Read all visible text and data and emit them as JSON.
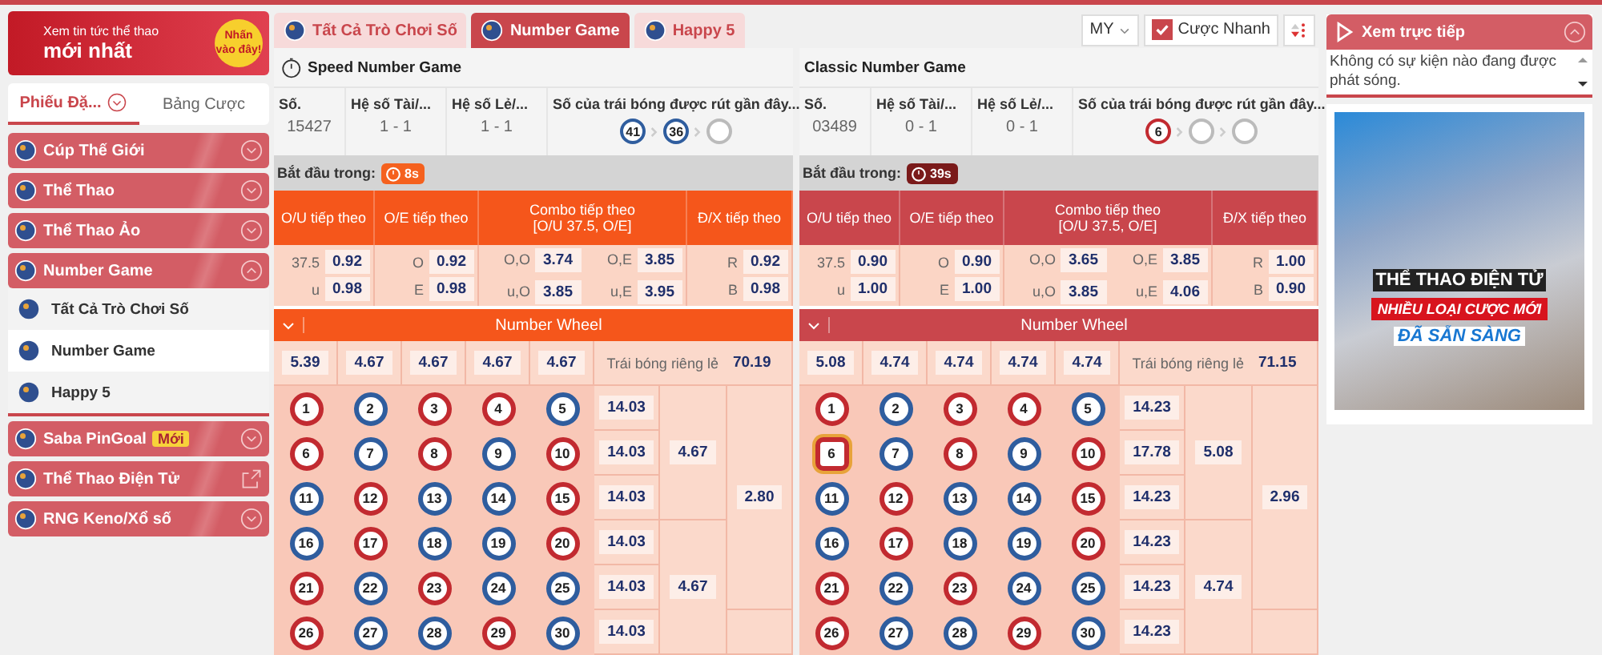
{
  "banner": {
    "line1": "Xem tin tức thể thao",
    "line2": "mới nhất",
    "cta": "Nhấn vào đây!"
  },
  "side_tabs": [
    {
      "label": "Phiếu Đặ...",
      "selected": true
    },
    {
      "label": "Bảng Cược",
      "selected": false
    }
  ],
  "menu": [
    {
      "label": "Cúp Thế Giới",
      "kind": "group",
      "expanded": false
    },
    {
      "label": "Thể Thao",
      "kind": "group",
      "expanded": false
    },
    {
      "label": "Thể Thao Ảo",
      "kind": "group",
      "expanded": false
    },
    {
      "label": "Number Game",
      "kind": "group",
      "expanded": true,
      "children": [
        {
          "label": "Tất Cả Trò Chơi Số",
          "selected": false
        },
        {
          "label": "Number Game",
          "selected": true
        },
        {
          "label": "Happy 5",
          "selected": false
        }
      ]
    },
    {
      "label": "Saba PinGoal",
      "kind": "group",
      "expanded": false,
      "badge": "Mới"
    },
    {
      "label": "Thể Thao Điện Tử",
      "kind": "external"
    },
    {
      "label": "RNG Keno/Xổ số",
      "kind": "group",
      "expanded": false
    }
  ],
  "tabs": [
    {
      "label": "Tất Cả Trò Chơi Số",
      "selected": false
    },
    {
      "label": "Number Game",
      "selected": true
    },
    {
      "label": "Happy 5",
      "selected": false
    }
  ],
  "toolbar": {
    "odds_type": "MY",
    "quick_bet": {
      "label": "Cược Nhanh",
      "checked": true
    }
  },
  "panels": [
    {
      "title": "Speed Number Game",
      "timed": true,
      "color": "#f5561b",
      "info": [
        {
          "label": "Số.",
          "value": "15427"
        },
        {
          "label": "Hệ số Tài/...",
          "value": "1 - 1"
        },
        {
          "label": "Hệ số Lẻ/...",
          "value": "1 - 1"
        }
      ],
      "recent_label": "Số của trái bóng được rút gần đây...",
      "recent": [
        {
          "n": "41",
          "color": "#2f5d9e"
        },
        {
          "n": "36",
          "color": "#2f5d9e"
        },
        {
          "color": "#bbbbbb"
        }
      ],
      "start_label": "Bắt đầu trong:",
      "timer": {
        "text": "8s",
        "color": "#f5611e"
      },
      "odds_headers": [
        "O/U tiếp theo",
        "O/E tiếp theo",
        "Combo tiếp theo\n[O/U 37.5, O/E]",
        "Đ/X tiếp theo"
      ],
      "odds": [
        [
          {
            "label": "37.5",
            "odds": "0.92"
          },
          {
            "label": "u",
            "odds": "0.98"
          }
        ],
        [
          {
            "label": "O",
            "odds": "0.92"
          },
          {
            "label": "E",
            "odds": "0.98"
          }
        ],
        [
          {
            "label": "O,O",
            "odds": "3.74"
          },
          {
            "label": "O,E",
            "odds": "3.85"
          },
          {
            "label": "u,O",
            "odds": "3.85"
          },
          {
            "label": "u,E",
            "odds": "3.95"
          }
        ],
        [
          {
            "label": "R",
            "odds": "0.92"
          },
          {
            "label": "B",
            "odds": "0.98"
          }
        ]
      ],
      "wheel_title": "Number Wheel",
      "column_odds": [
        "5.39",
        "4.67",
        "4.67",
        "4.67",
        "4.67"
      ],
      "single_label": "Trái bóng riêng lẻ",
      "single_odds": "70.19",
      "row_odds": [
        "14.03",
        "14.03",
        "14.03",
        "14.03",
        "14.03",
        "14.03"
      ],
      "group_odds": [
        "4.67",
        "4.67"
      ],
      "half_odds": [
        "2.80"
      ],
      "balls": [
        {
          "n": "1",
          "color": "#c22a30",
          "selected": false
        },
        {
          "n": "2",
          "color": "#2f5d9e",
          "selected": false
        },
        {
          "n": "3",
          "color": "#c22a30",
          "selected": false
        },
        {
          "n": "4",
          "color": "#c22a30",
          "selected": false
        },
        {
          "n": "5",
          "color": "#2f5d9e",
          "selected": false
        },
        {
          "n": "6",
          "color": "#c22a30",
          "selected": false
        },
        {
          "n": "7",
          "color": "#2f5d9e",
          "selected": false
        },
        {
          "n": "8",
          "color": "#c22a30",
          "selected": false
        },
        {
          "n": "9",
          "color": "#2f5d9e",
          "selected": false
        },
        {
          "n": "10",
          "color": "#c22a30",
          "selected": false
        },
        {
          "n": "11",
          "color": "#2f5d9e",
          "selected": false
        },
        {
          "n": "12",
          "color": "#c22a30",
          "selected": false
        },
        {
          "n": "13",
          "color": "#2f5d9e",
          "selected": false
        },
        {
          "n": "14",
          "color": "#2f5d9e",
          "selected": false
        },
        {
          "n": "15",
          "color": "#c22a30",
          "selected": false
        },
        {
          "n": "16",
          "color": "#2f5d9e",
          "selected": false
        },
        {
          "n": "17",
          "color": "#c22a30",
          "selected": false
        },
        {
          "n": "18",
          "color": "#2f5d9e",
          "selected": false
        },
        {
          "n": "19",
          "color": "#2f5d9e",
          "selected": false
        },
        {
          "n": "20",
          "color": "#c22a30",
          "selected": false
        },
        {
          "n": "21",
          "color": "#c22a30",
          "selected": false
        },
        {
          "n": "22",
          "color": "#2f5d9e",
          "selected": false
        },
        {
          "n": "23",
          "color": "#c22a30",
          "selected": false
        },
        {
          "n": "24",
          "color": "#2f5d9e",
          "selected": false
        },
        {
          "n": "25",
          "color": "#2f5d9e",
          "selected": false
        },
        {
          "n": "26",
          "color": "#c22a30",
          "selected": false
        },
        {
          "n": "27",
          "color": "#2f5d9e",
          "selected": false
        },
        {
          "n": "28",
          "color": "#2f5d9e",
          "selected": false
        },
        {
          "n": "29",
          "color": "#c22a30",
          "selected": false
        },
        {
          "n": "30",
          "color": "#2f5d9e",
          "selected": false
        }
      ]
    },
    {
      "title": "Classic Number Game",
      "timed": false,
      "color": "#c9464c",
      "info": [
        {
          "label": "Số.",
          "value": "03489"
        },
        {
          "label": "Hệ số Tài/...",
          "value": "0 - 1"
        },
        {
          "label": "Hệ số Lẻ/...",
          "value": "0 - 1"
        }
      ],
      "recent_label": "Số của trái bóng được rút gần đây...",
      "recent": [
        {
          "n": "6",
          "color": "#c22a30"
        },
        {
          "color": "#bbbbbb"
        },
        {
          "color": "#bbbbbb"
        }
      ],
      "start_label": "Bắt đầu trong:",
      "timer": {
        "text": "39s",
        "color": "#7a1a1a"
      },
      "odds_headers": [
        "O/U tiếp theo",
        "O/E tiếp theo",
        "Combo tiếp theo\n[O/U 37.5, O/E]",
        "Đ/X tiếp theo"
      ],
      "odds": [
        [
          {
            "label": "37.5",
            "odds": "0.90"
          },
          {
            "label": "u",
            "odds": "1.00"
          }
        ],
        [
          {
            "label": "O",
            "odds": "0.90"
          },
          {
            "label": "E",
            "odds": "1.00"
          }
        ],
        [
          {
            "label": "O,O",
            "odds": "3.65"
          },
          {
            "label": "O,E",
            "odds": "3.85"
          },
          {
            "label": "u,O",
            "odds": "3.85"
          },
          {
            "label": "u,E",
            "odds": "4.06"
          }
        ],
        [
          {
            "label": "R",
            "odds": "1.00"
          },
          {
            "label": "B",
            "odds": "0.90"
          }
        ]
      ],
      "wheel_title": "Number Wheel",
      "column_odds": [
        "5.08",
        "4.74",
        "4.74",
        "4.74",
        "4.74"
      ],
      "single_label": "Trái bóng riêng lẻ",
      "single_odds": "71.15",
      "row_odds": [
        "14.23",
        "17.78",
        "14.23",
        "14.23",
        "14.23",
        "14.23"
      ],
      "group_odds": [
        "5.08",
        "4.74"
      ],
      "half_odds": [
        "2.96"
      ],
      "balls": [
        {
          "n": "1",
          "color": "#c22a30",
          "selected": false
        },
        {
          "n": "2",
          "color": "#2f5d9e",
          "selected": false
        },
        {
          "n": "3",
          "color": "#c22a30",
          "selected": false
        },
        {
          "n": "4",
          "color": "#c22a30",
          "selected": false
        },
        {
          "n": "5",
          "color": "#2f5d9e",
          "selected": false
        },
        {
          "n": "6",
          "color": "#c22a30",
          "selected": true
        },
        {
          "n": "7",
          "color": "#2f5d9e",
          "selected": false
        },
        {
          "n": "8",
          "color": "#c22a30",
          "selected": false
        },
        {
          "n": "9",
          "color": "#2f5d9e",
          "selected": false
        },
        {
          "n": "10",
          "color": "#c22a30",
          "selected": false
        },
        {
          "n": "11",
          "color": "#2f5d9e",
          "selected": false
        },
        {
          "n": "12",
          "color": "#c22a30",
          "selected": false
        },
        {
          "n": "13",
          "color": "#2f5d9e",
          "selected": false
        },
        {
          "n": "14",
          "color": "#2f5d9e",
          "selected": false
        },
        {
          "n": "15",
          "color": "#c22a30",
          "selected": false
        },
        {
          "n": "16",
          "color": "#2f5d9e",
          "selected": false
        },
        {
          "n": "17",
          "color": "#c22a30",
          "selected": false
        },
        {
          "n": "18",
          "color": "#2f5d9e",
          "selected": false
        },
        {
          "n": "19",
          "color": "#2f5d9e",
          "selected": false
        },
        {
          "n": "20",
          "color": "#c22a30",
          "selected": false
        },
        {
          "n": "21",
          "color": "#c22a30",
          "selected": false
        },
        {
          "n": "22",
          "color": "#2f5d9e",
          "selected": false
        },
        {
          "n": "23",
          "color": "#c22a30",
          "selected": false
        },
        {
          "n": "24",
          "color": "#2f5d9e",
          "selected": false
        },
        {
          "n": "25",
          "color": "#2f5d9e",
          "selected": false
        },
        {
          "n": "26",
          "color": "#c22a30",
          "selected": false
        },
        {
          "n": "27",
          "color": "#2f5d9e",
          "selected": false
        },
        {
          "n": "28",
          "color": "#2f5d9e",
          "selected": false
        },
        {
          "n": "29",
          "color": "#c22a30",
          "selected": false
        },
        {
          "n": "30",
          "color": "#2f5d9e",
          "selected": false
        }
      ]
    }
  ],
  "live": {
    "title": "Xem trực tiếp",
    "expanded": true,
    "message": "Không có sự kiện nào đang được phát sóng."
  },
  "ad": {
    "line1": "THỂ THAO ĐIỆN TỬ",
    "line2": "NHIỀU LOẠI CƯỢC MỚI",
    "line3": "ĐÃ SẴN SÀNG"
  }
}
